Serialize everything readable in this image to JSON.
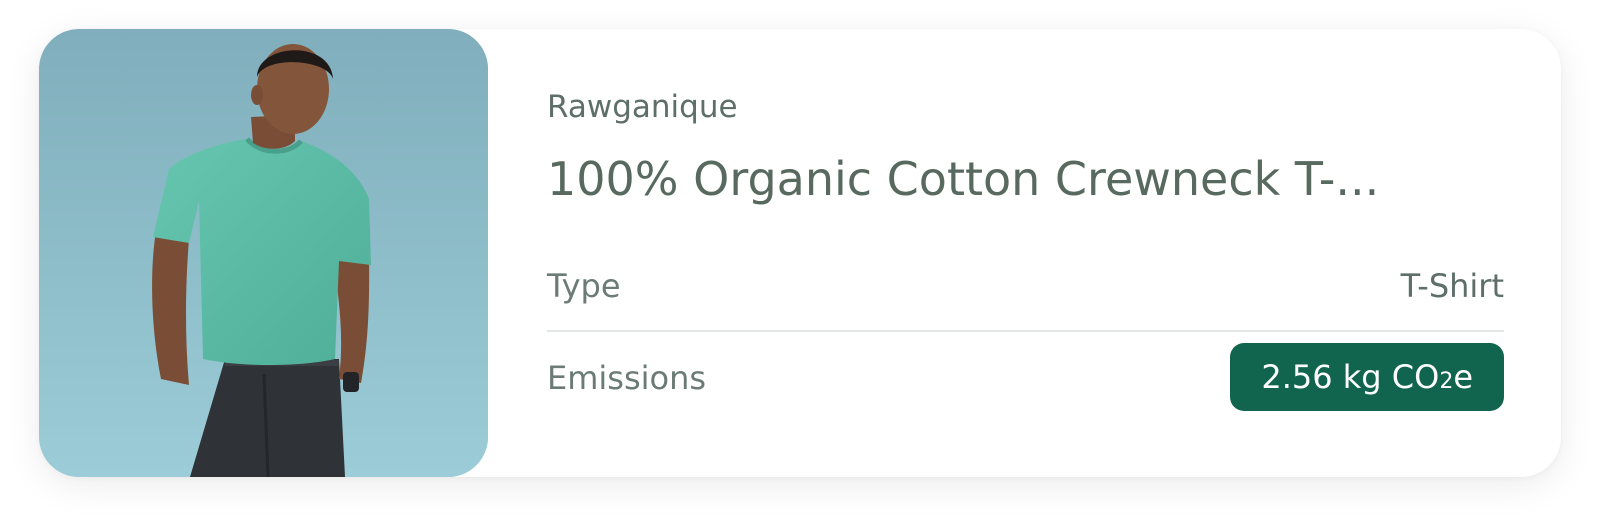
{
  "product": {
    "brand": "Rawganique",
    "title": "100% Organic Cotton Crewneck T-...",
    "image_alt": "Man wearing a teal crewneck t-shirt and dark jeans"
  },
  "attributes": {
    "type_label": "Type",
    "type_value": "T-Shirt",
    "emissions_label": "Emissions",
    "emissions_amount": "2.56 kg CO",
    "emissions_subscript": "2",
    "emissions_suffix": "e"
  },
  "colors": {
    "badge_background": "#11654f",
    "photo_background": "#8fbfcc",
    "shirt": "#5fbfa9"
  }
}
